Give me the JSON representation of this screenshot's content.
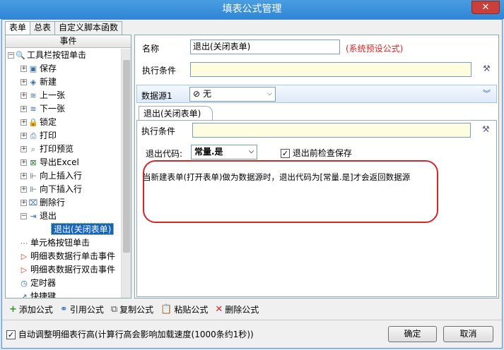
{
  "window": {
    "title": "填表公式管理",
    "close": "✕"
  },
  "tabs": [
    "表单",
    "总表",
    "自定义脚本函数"
  ],
  "left": {
    "header": "事件",
    "nodes": [
      {
        "label": "工具栏按钮单击",
        "pm": "⊟",
        "icon": "🔍"
      },
      {
        "label": "保存",
        "pm": "⊞",
        "icon": "⊡"
      },
      {
        "label": "新建",
        "pm": "⊞",
        "icon": "♡"
      },
      {
        "label": "上一张",
        "pm": "⊞",
        "icon": "≋"
      },
      {
        "label": "下一张",
        "pm": "⊞",
        "icon": "≋"
      },
      {
        "label": "锁定",
        "pm": "⊞",
        "icon": "🔒"
      },
      {
        "label": "打印",
        "pm": "⊞",
        "icon": "⎙"
      },
      {
        "label": "打印预览",
        "pm": "⊞",
        "icon": "🔎"
      },
      {
        "label": "导出Excel",
        "pm": "⊞",
        "icon": "⊠"
      },
      {
        "label": "向上插入行",
        "pm": "⊞",
        "icon": "⇞"
      },
      {
        "label": "向下插入行",
        "pm": "⊞",
        "icon": "⇟"
      },
      {
        "label": "删除行",
        "pm": "⊞",
        "icon": "⌧"
      },
      {
        "label": "退出",
        "pm": "⊟",
        "icon": "⇥"
      },
      {
        "label": "退出(关闭表单)",
        "pm": "",
        "icon": ""
      },
      {
        "label": "单元格按钮单击",
        "pm": "",
        "icon": "⋯"
      },
      {
        "label": "明细表数据行单击事件",
        "pm": "",
        "icon": "▷"
      },
      {
        "label": "明细表数据行双击事件",
        "pm": "",
        "icon": "▷"
      },
      {
        "label": "定时器",
        "pm": "",
        "icon": "⏲"
      },
      {
        "label": "快捷键",
        "pm": "",
        "icon": "↗"
      }
    ]
  },
  "form": {
    "name_label": "名称",
    "name_value": "退出(关闭表单)",
    "name_note": "(系统预设公式)",
    "cond_label": "执行条件",
    "cond_value": "",
    "ds_label": "数据源1",
    "ds_value": "无",
    "subtab": "退出(关闭表单)",
    "sub_cond_label": "执行条件",
    "sub_cond_value": "",
    "exit_code_label": "退出代码:",
    "exit_code_value": "常量.是",
    "check_label": "退出前检查保存",
    "checked": "✓",
    "note": "当新建表单(打开表单)做为数据源时，退出代码为[常量.是]才会返回数据源"
  },
  "footer": {
    "add": "添加公式",
    "ref": "引用公式",
    "copy": "复制公式",
    "paste": "粘贴公式",
    "delete": "删除公式"
  },
  "bottom": {
    "auto_adjust": "自动调整明细表行高(计算行高会影响加载速度(1000条约1秒))",
    "auto_checked": "✓",
    "ok": "确定",
    "cancel": "取消"
  }
}
